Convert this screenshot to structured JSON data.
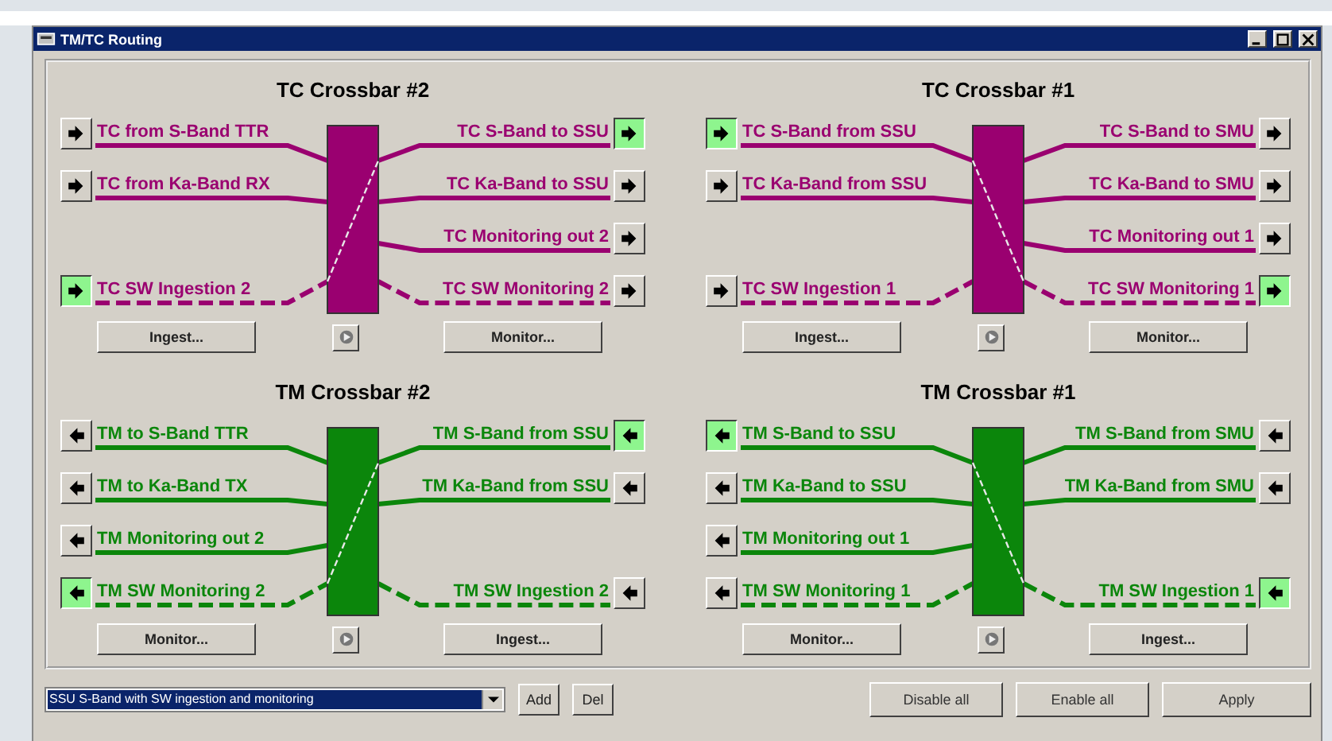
{
  "window": {
    "title": "TM/TC Routing"
  },
  "crossbars": [
    {
      "title": "TC Crossbar #2",
      "kind": "tc",
      "rising": true,
      "rows": [
        {
          "left": {
            "label": "TC from S-Band TTR",
            "active": false,
            "dashed": false
          },
          "right": {
            "label": "TC S-Band to SSU",
            "active": true,
            "dashed": false
          }
        },
        {
          "left": {
            "label": "TC from Ka-Band RX",
            "active": false,
            "dashed": false
          },
          "right": {
            "label": "TC Ka-Band to SSU",
            "active": false,
            "dashed": false
          }
        },
        {
          "right": {
            "label": "TC Monitoring out 2",
            "active": false,
            "dashed": false
          }
        },
        {
          "left": {
            "label": "TC SW Ingestion 2",
            "active": true,
            "dashed": true
          },
          "right": {
            "label": "TC SW Monitoring 2",
            "active": false,
            "dashed": true
          }
        }
      ],
      "left_button": "Ingest...",
      "right_button": "Monitor..."
    },
    {
      "title": "TC Crossbar #1",
      "kind": "tc",
      "rising": false,
      "rows": [
        {
          "left": {
            "label": "TC S-Band from SSU",
            "active": true,
            "dashed": false
          },
          "right": {
            "label": "TC S-Band to SMU",
            "active": false,
            "dashed": false
          }
        },
        {
          "left": {
            "label": "TC Ka-Band from SSU",
            "active": false,
            "dashed": false
          },
          "right": {
            "label": "TC Ka-Band to SMU",
            "active": false,
            "dashed": false
          }
        },
        {
          "right": {
            "label": "TC Monitoring out 1",
            "active": false,
            "dashed": false
          }
        },
        {
          "left": {
            "label": "TC SW Ingestion 1",
            "active": false,
            "dashed": true
          },
          "right": {
            "label": "TC SW Monitoring 1",
            "active": true,
            "dashed": true
          }
        }
      ],
      "left_button": "Ingest...",
      "right_button": "Monitor..."
    },
    {
      "title": "TM Crossbar #2",
      "kind": "tm",
      "rising": true,
      "rows": [
        {
          "left": {
            "label": "TM to S-Band TTR",
            "active": false,
            "dashed": false
          },
          "right": {
            "label": "TM S-Band from SSU",
            "active": true,
            "dashed": false
          }
        },
        {
          "left": {
            "label": "TM to Ka-Band TX",
            "active": false,
            "dashed": false
          },
          "right": {
            "label": "TM Ka-Band from SSU",
            "active": false,
            "dashed": false
          }
        },
        {
          "left": {
            "label": "TM Monitoring out 2",
            "active": false,
            "dashed": false
          }
        },
        {
          "left": {
            "label": "TM SW Monitoring 2",
            "active": true,
            "dashed": true
          },
          "right": {
            "label": "TM SW Ingestion 2",
            "active": false,
            "dashed": true
          }
        }
      ],
      "left_button": "Monitor...",
      "right_button": "Ingest..."
    },
    {
      "title": "TM Crossbar #1",
      "kind": "tm",
      "rising": false,
      "rows": [
        {
          "left": {
            "label": "TM S-Band to SSU",
            "active": true,
            "dashed": false
          },
          "right": {
            "label": "TM S-Band from SMU",
            "active": false,
            "dashed": false
          }
        },
        {
          "left": {
            "label": "TM Ka-Band to SSU",
            "active": false,
            "dashed": false
          },
          "right": {
            "label": "TM Ka-Band from SMU",
            "active": false,
            "dashed": false
          }
        },
        {
          "left": {
            "label": "TM Monitoring out 1",
            "active": false,
            "dashed": false
          }
        },
        {
          "left": {
            "label": "TM SW Monitoring 1",
            "active": false,
            "dashed": true
          },
          "right": {
            "label": "TM SW Ingestion 1",
            "active": true,
            "dashed": true
          }
        }
      ],
      "left_button": "Monitor...",
      "right_button": "Ingest..."
    }
  ],
  "footer": {
    "configuration": "SSU S-Band with SW ingestion and monitoring",
    "buttons_left": [
      "Add",
      "Del"
    ],
    "buttons_right": [
      "Disable all",
      "Enable all",
      "Apply"
    ]
  }
}
